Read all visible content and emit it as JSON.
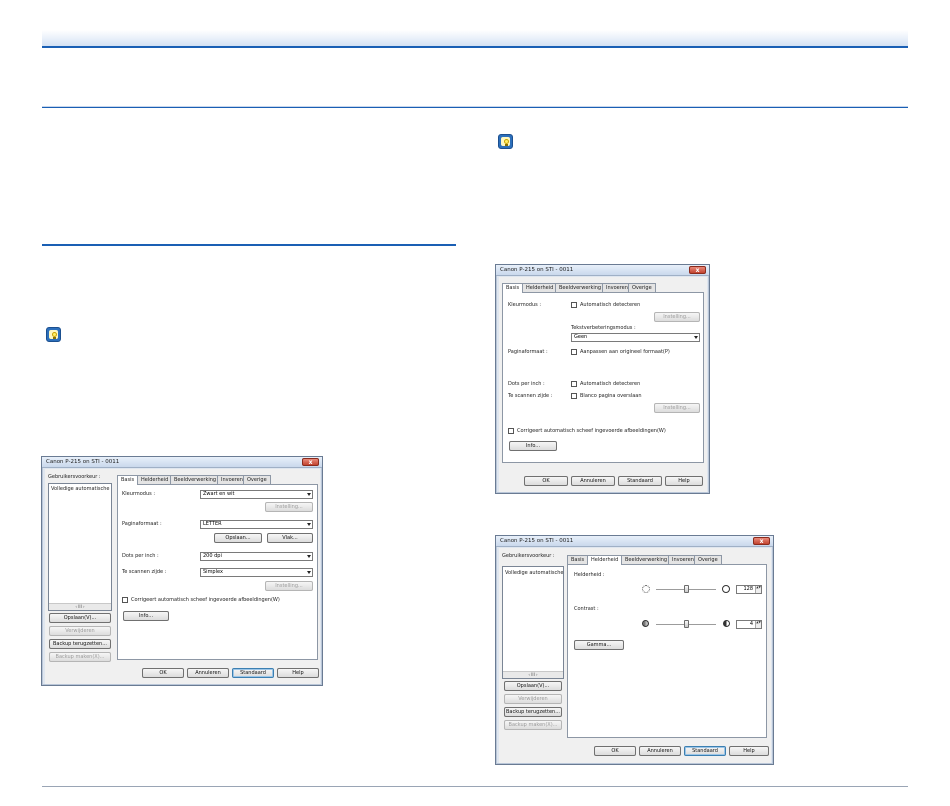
{
  "dialog1": {
    "title": "Canon P-215 on STI - 0011",
    "close": "x",
    "user_prefs_label": "Gebruikersvoorkeur :",
    "prefs_list": [
      "Volledige automatische"
    ],
    "scroll_label": "‹     III     ›",
    "side_buttons": [
      "Opslaan(V)...",
      "Verwijderen",
      "Backup terugzetten...",
      "Backup maken(X)..."
    ],
    "tabs": [
      "Basis",
      "Helderheid",
      "Beeldverwerking",
      "Invoeren",
      "Overige"
    ],
    "color_mode_label": "Kleurmodus :",
    "color_mode_value": "Zwart en wit",
    "settings_button": "Instelling...",
    "page_size_label": "Paginaformaat :",
    "page_size_value": "LETTER",
    "save_button": "Opslaan...",
    "area_button": "Vlak...",
    "dpi_label": "Dots per inch :",
    "dpi_value": "200 dpi",
    "side_label": "Te scannen zijde :",
    "side_value": "Simplex",
    "settings_button2": "Instelling...",
    "deskew_label": "Corrigeert automatisch scheef ingevoerde afbeeldingen(W)",
    "info_button": "Info...",
    "footer_buttons": [
      "OK",
      "Annuleren",
      "Standaard",
      "Help"
    ]
  },
  "dialog2": {
    "title": "Canon P-215 on STI - 0011",
    "close": "x",
    "tabs": [
      "Basis",
      "Helderheid",
      "Beeldverwerking",
      "Invoeren",
      "Overige"
    ],
    "color_mode_label": "Kleurmodus :",
    "auto_detect_label": "Automatisch detecteren",
    "settings_button": "Instelling...",
    "text_mode_label": "Tekstverbeteringsmodus :",
    "text_mode_value": "Geen",
    "page_size_label": "Paginaformaat :",
    "fit_original_label": "Aanpassen aan origineel formaat(P)",
    "dpi_label": "Dots per inch :",
    "dpi_auto_label": "Automatisch detecteren",
    "side_label": "Te scannen zijde :",
    "skip_blank_label": "Blanco pagina overslaan",
    "settings_button2": "Instelling...",
    "deskew_label": "Corrigeert automatisch scheef ingevoerde afbeeldingen(W)",
    "info_button": "Info...",
    "footer_buttons": [
      "OK",
      "Annuleren",
      "Standaard",
      "Help"
    ]
  },
  "dialog3": {
    "title": "Canon P-215 on STI - 0011",
    "close": "x",
    "user_prefs_label": "Gebruikersvoorkeur :",
    "prefs_list": [
      "Volledige automatische"
    ],
    "scroll_label": "‹     III     ›",
    "side_buttons": [
      "Opslaan(V)...",
      "Verwijderen",
      "Backup terugzetten...",
      "Backup maken(X)..."
    ],
    "tabs": [
      "Basis",
      "Helderheid",
      "Beeldverwerking",
      "Invoeren",
      "Overige"
    ],
    "brightness_label": "Helderheid :",
    "brightness_value": "128",
    "brightness_level": 0.5,
    "contrast_label": "Contrast :",
    "contrast_value": "4",
    "contrast_level": 0.5,
    "spin_arrows": "▲▼",
    "gamma_button": "Gamma...",
    "footer_buttons": [
      "OK",
      "Annuleren",
      "Standaard",
      "Help"
    ]
  }
}
